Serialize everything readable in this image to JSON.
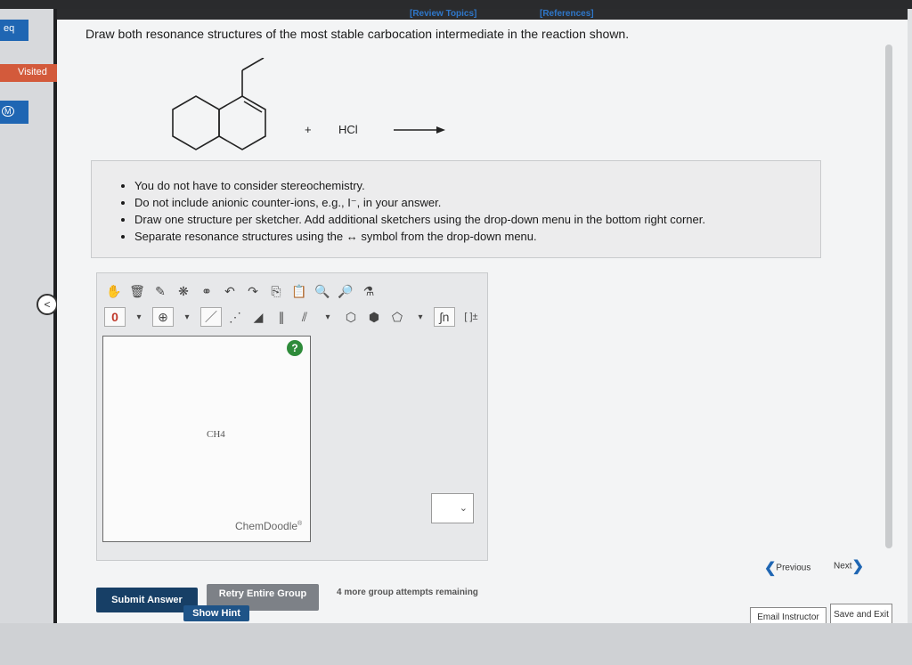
{
  "side": {
    "chip_eq": "eq",
    "chip_visited": "Visited",
    "chip_m": "M"
  },
  "header": {
    "review_topics": "[Review Topics]",
    "references": "[References]"
  },
  "question": "Draw both resonance structures of the most stable carbocation intermediate in the reaction shown.",
  "reaction": {
    "plus": "+",
    "reagent": "HCl"
  },
  "notes": [
    "You do not have to consider stereochemistry.",
    "Do not include anionic counter-ions, e.g., I⁻, in your answer.",
    "Draw one structure per sketcher. Add additional sketchers using the drop-down menu in the bottom right corner.",
    "Separate resonance structures using the ↔ symbol from the drop-down menu."
  ],
  "sketcher": {
    "charge_label": "0",
    "bracket_label": "[ ]±",
    "help": "?",
    "molecule": "CH4",
    "brand": "ChemDoodle",
    "brand_mark": "®"
  },
  "buttons": {
    "submit": "Submit Answer",
    "retry": "Retry Entire Group",
    "hint": "Show Hint",
    "remaining": "4 more group attempts remaining"
  },
  "nav": {
    "previous": "Previous",
    "next": "Next",
    "email": "Email Instructor",
    "save_exit": "Save and Exit"
  }
}
